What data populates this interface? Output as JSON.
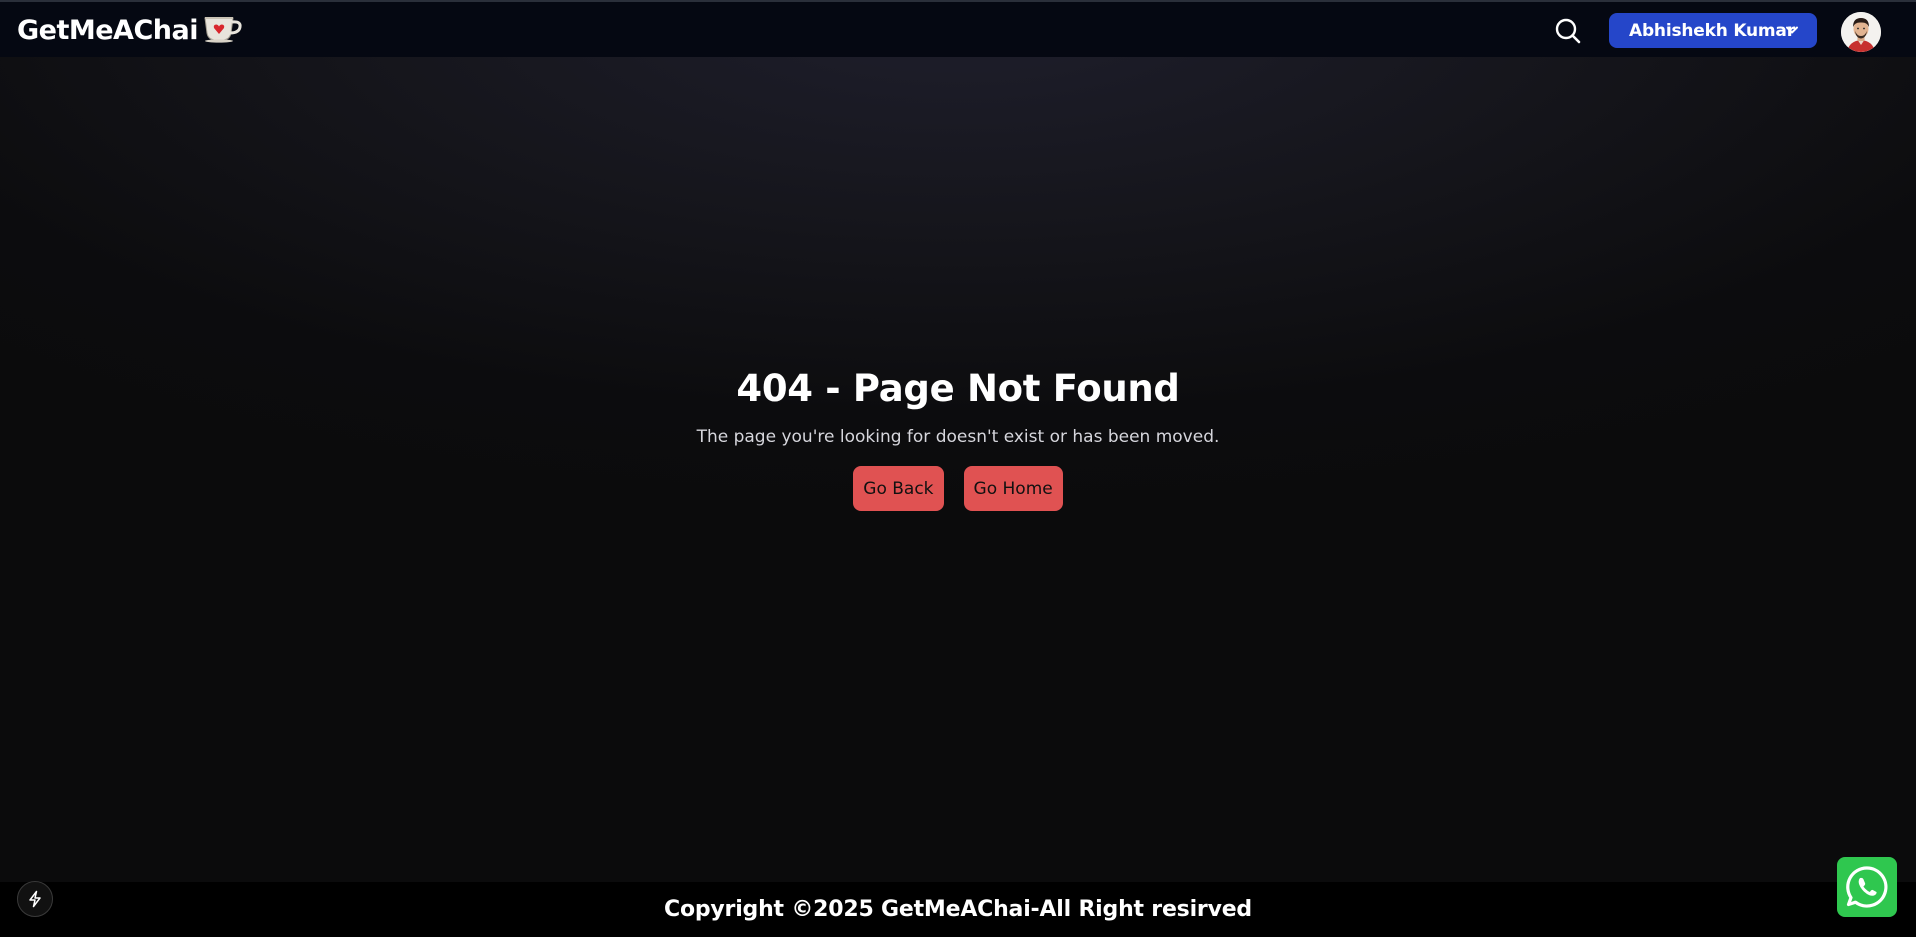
{
  "navbar": {
    "brand": "GetMeAChai",
    "brand_icon": "tea-cup-icon",
    "search_icon": "search-icon",
    "user_name": "Abhishekh Kumar",
    "user_chevron_icon": "chevron-down-icon",
    "accent_color": "#2546c9"
  },
  "main": {
    "title": "404 - Page Not Found",
    "message": "The page you're looking for doesn't exist or has been moved.",
    "buttons": {
      "back": "Go Back",
      "home": "Go Home"
    },
    "button_color": "#e05252"
  },
  "footer": {
    "text": "Copyright ©2025 GetMeAChai-All Right resirved"
  },
  "widgets": {
    "dev_indicator_icon": "lightning-icon",
    "chat_icon": "whatsapp-icon",
    "chat_color": "#2fc74f"
  }
}
